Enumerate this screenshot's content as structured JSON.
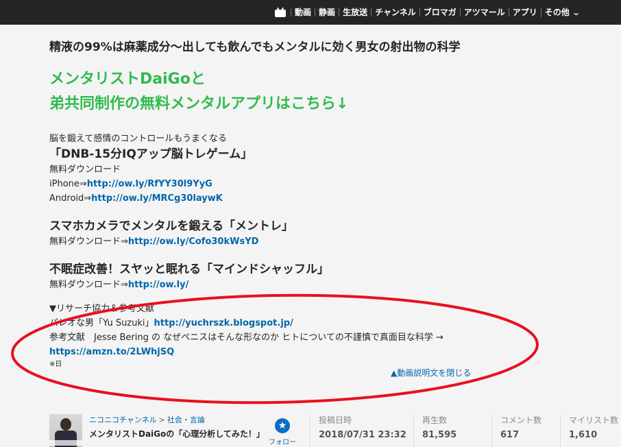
{
  "topnav": {
    "icon": "niconico-tv-icon",
    "items": [
      "動画",
      "静画",
      "生放送",
      "チャンネル",
      "ブロマガ",
      "アツマール",
      "アプリ",
      "その他"
    ]
  },
  "video": {
    "title": "精液の99%は麻薬成分〜出しても飲んでもメンタルに効く男女の射出物の科学"
  },
  "promo": {
    "line1": "メンタリストDaiGoと",
    "line2": "弟共同制作の無料メンタルアプリはこちら↓"
  },
  "description": {
    "app1": {
      "lead": "脳を鍛えて感情のコントロールもうまくなる",
      "name": "「DNB-15分IQアップ脳トレゲーム」",
      "download": "無料ダウンロード",
      "iphone_label": "iPhone⇒",
      "iphone_url": "http://ow.ly/RfYY30l9YyG",
      "android_label": "Android⇒",
      "android_url": "http://ow.ly/MRCg30laywK"
    },
    "app2": {
      "name": "スマホカメラでメンタルを鍛える「メントレ」",
      "download_label": "無料ダウンロード⇒",
      "url": "http://ow.ly/Cofo30kWsYD"
    },
    "app3": {
      "name": "不眠症改善！スヤッと眠れる「マインドシャッフル」",
      "download_label": "無料ダウンロード⇒",
      "url": "http://ow.ly/"
    },
    "research": {
      "heading": "▼リサーチ協力＆参考文献",
      "collab_label": "パレオな男「Yu Suzuki」",
      "collab_url": "http://yuchrszk.blogspot.jp/",
      "ref_label": "参考文献　Jesse Bering の なぜペニスはそんな形なのか ヒトについての不謹慎で真面目な科学 →",
      "ref_url": "https://amzn.to/2LWhjSQ",
      "note": "※日"
    }
  },
  "close_description": "▲動画説明文を閉じる",
  "channel": {
    "breadcrumb_1": "ニコニコチャンネル",
    "breadcrumb_sep": ">",
    "breadcrumb_2": "社会・言論",
    "name": "メンタリストDaiGoの「心理分析してみた！」",
    "follow_label": "フォロー"
  },
  "stats": [
    {
      "label": "投稿日時",
      "value": "2018/07/31 23:32"
    },
    {
      "label": "再生数",
      "value": "81,595"
    },
    {
      "label": "コメント数",
      "value": "617"
    },
    {
      "label": "マイリスト数",
      "value": "1,610"
    }
  ],
  "colors": {
    "topbar": "#252525",
    "promo_green": "#2fbb4f",
    "link_blue": "#0066aa",
    "annotation_red": "#e8101e"
  }
}
